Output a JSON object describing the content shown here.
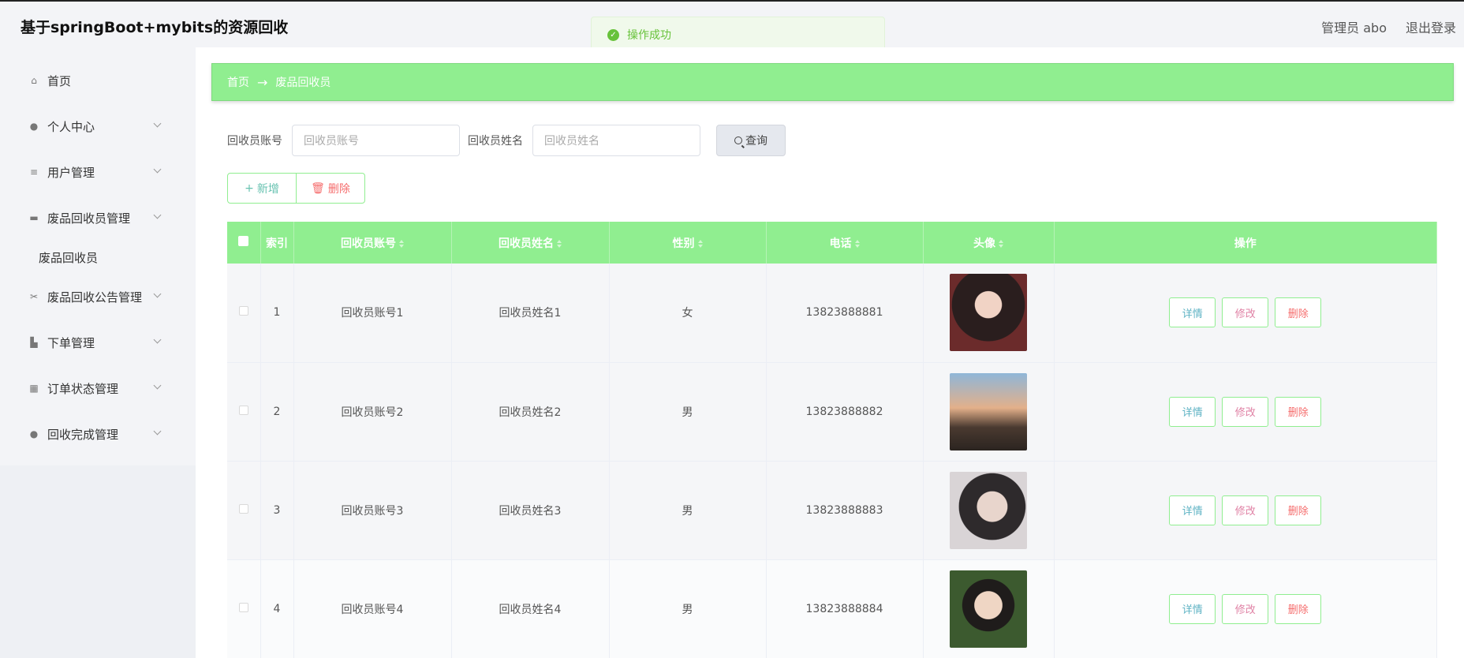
{
  "header": {
    "title": "基于springBoot+mybits的资源回收",
    "user": "管理员 abo",
    "logout": "退出登录"
  },
  "toast": {
    "message": "操作成功"
  },
  "sidebar": {
    "items": [
      {
        "label": "首页",
        "icon": "home-icon"
      },
      {
        "label": "个人中心",
        "icon": "user-icon"
      },
      {
        "label": "用户管理",
        "icon": "list-icon"
      },
      {
        "label": "废品回收员管理",
        "icon": "monitor-icon"
      },
      {
        "label": "废品回收员",
        "icon": ""
      },
      {
        "label": "废品回收公告管理",
        "icon": "ticket-icon"
      },
      {
        "label": "下单管理",
        "icon": "thumb-icon"
      },
      {
        "label": "订单状态管理",
        "icon": "grid-icon"
      },
      {
        "label": "回收完成管理",
        "icon": "user-icon"
      }
    ]
  },
  "breadcrumb": {
    "home": "首页",
    "arrow": "→",
    "current": "废品回收员"
  },
  "search": {
    "account_label": "回收员账号",
    "account_placeholder": "回收员账号",
    "name_label": "回收员姓名",
    "name_placeholder": "回收员姓名",
    "button": "查询"
  },
  "actions": {
    "add": "新增",
    "delete": "删除"
  },
  "table": {
    "headers": [
      "索引",
      "回收员账号",
      "回收员姓名",
      "性别",
      "电话",
      "头像",
      "操作"
    ],
    "rows": [
      {
        "index": "1",
        "account": "回收员账号1",
        "name": "回收员姓名1",
        "gender": "女",
        "phone": "13823888881"
      },
      {
        "index": "2",
        "account": "回收员账号2",
        "name": "回收员姓名2",
        "gender": "男",
        "phone": "13823888882"
      },
      {
        "index": "3",
        "account": "回收员账号3",
        "name": "回收员姓名3",
        "gender": "男",
        "phone": "13823888883"
      },
      {
        "index": "4",
        "account": "回收员账号4",
        "name": "回收员姓名4",
        "gender": "男",
        "phone": "13823888884"
      }
    ],
    "op_labels": {
      "detail": "详情",
      "edit": "修改",
      "remove": "删除"
    }
  },
  "colors": {
    "accent": "#90ee90",
    "success": "#67c23a",
    "danger": "#f56c6c"
  }
}
